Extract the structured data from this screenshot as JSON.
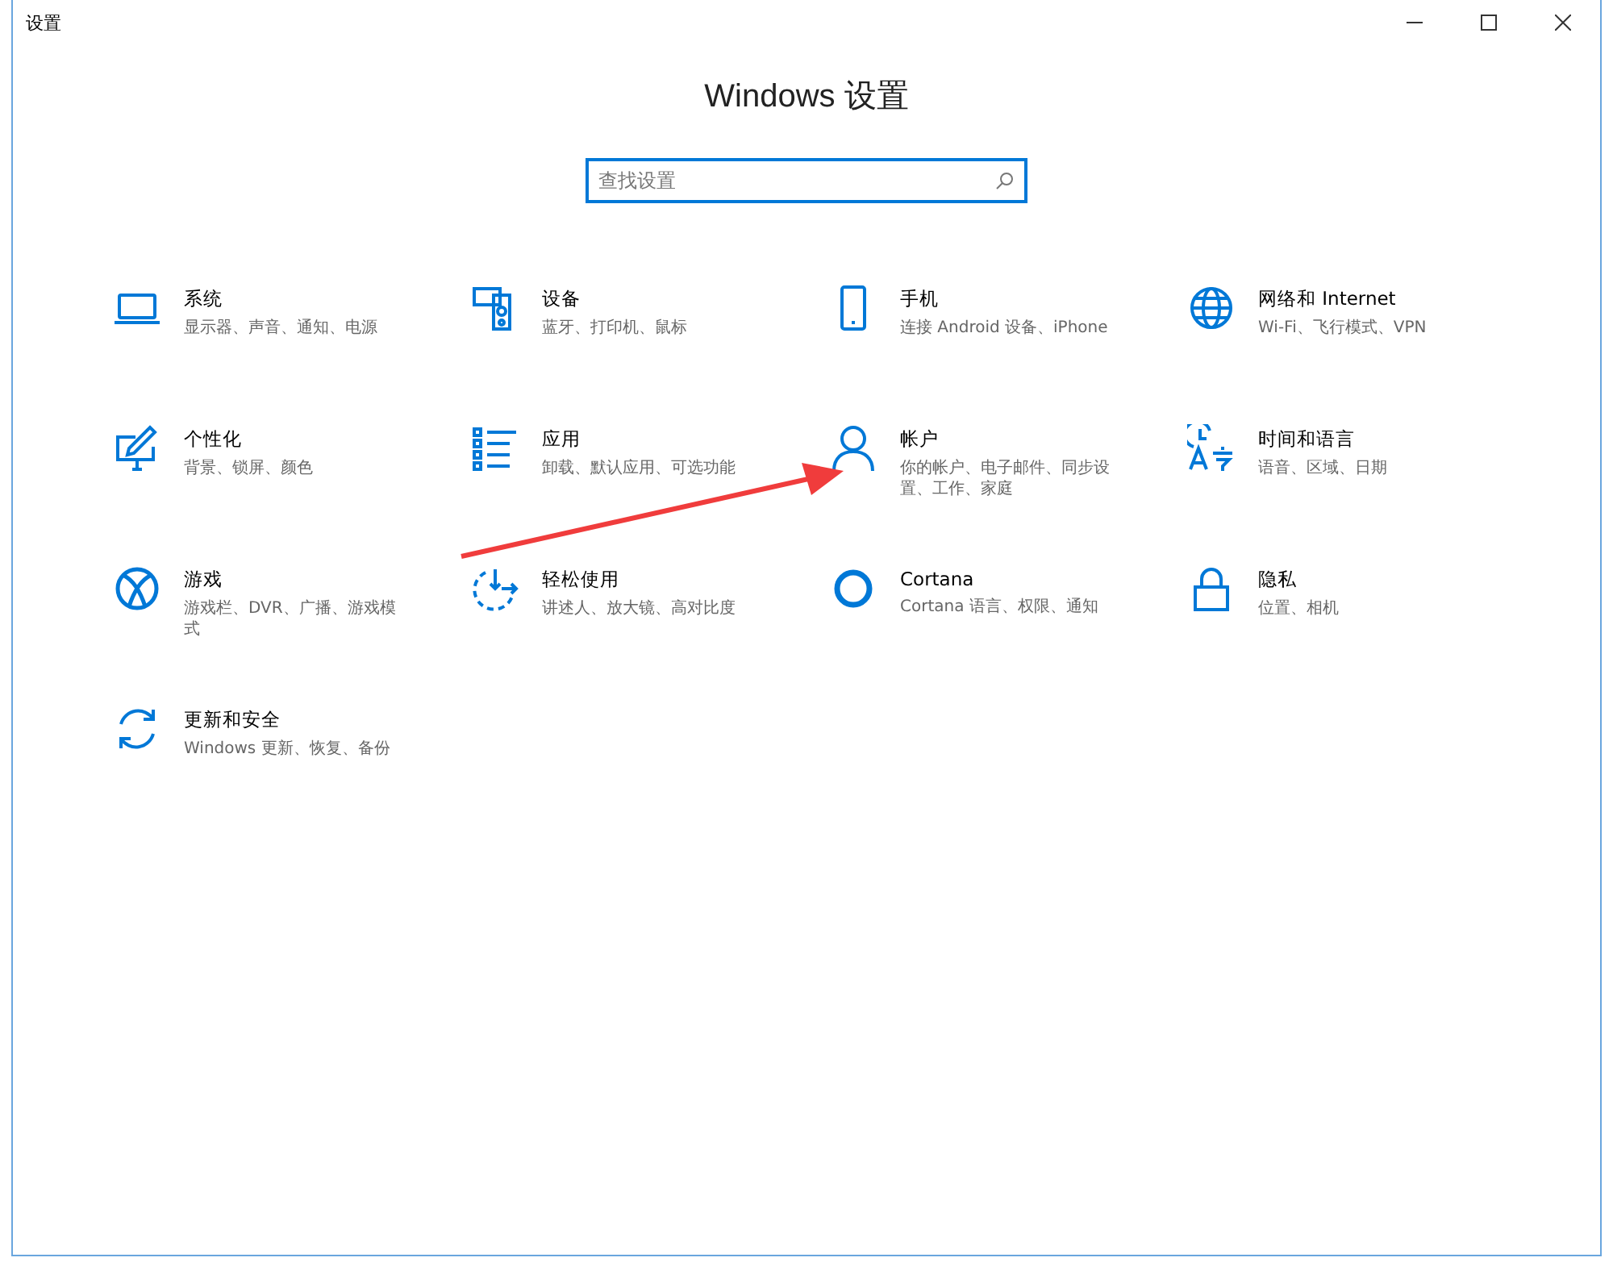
{
  "window": {
    "title": "设置"
  },
  "heading": "Windows 设置",
  "search": {
    "placeholder": "查找设置"
  },
  "items": [
    {
      "title": "系统",
      "subtitle": "显示器、声音、通知、电源"
    },
    {
      "title": "设备",
      "subtitle": "蓝牙、打印机、鼠标"
    },
    {
      "title": "手机",
      "subtitle": "连接 Android 设备、iPhone"
    },
    {
      "title": "网络和 Internet",
      "subtitle": "Wi-Fi、飞行模式、VPN"
    },
    {
      "title": "个性化",
      "subtitle": "背景、锁屏、颜色"
    },
    {
      "title": "应用",
      "subtitle": "卸载、默认应用、可选功能"
    },
    {
      "title": "帐户",
      "subtitle": "你的帐户、电子邮件、同步设置、工作、家庭"
    },
    {
      "title": "时间和语言",
      "subtitle": "语音、区域、日期"
    },
    {
      "title": "游戏",
      "subtitle": "游戏栏、DVR、广播、游戏模式"
    },
    {
      "title": "轻松使用",
      "subtitle": "讲述人、放大镜、高对比度"
    },
    {
      "title": "Cortana",
      "subtitle": "Cortana 语言、权限、通知"
    },
    {
      "title": "隐私",
      "subtitle": "位置、相机"
    },
    {
      "title": "更新和安全",
      "subtitle": "Windows 更新、恢复、备份"
    }
  ]
}
